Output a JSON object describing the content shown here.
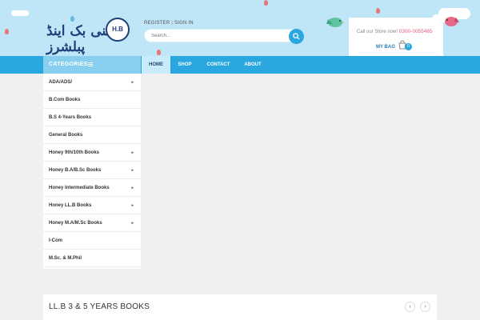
{
  "header": {
    "logo_text": "ہنی بک اینڈ پبلشرز",
    "logo_badge": "H.B",
    "register_label": "REGISTER",
    "signin_label": "SIGN IN",
    "separator": "|",
    "search_placeholder": "Search...",
    "call_label": "Call our Store now!",
    "phone": "0300-0055465",
    "bag_label": "MY BAG",
    "bag_count": "0"
  },
  "nav": {
    "categories_label": "CATEGORIES",
    "items": [
      {
        "label": "HOME"
      },
      {
        "label": "SHOP"
      },
      {
        "label": "CONTACT"
      },
      {
        "label": "ABOUT"
      }
    ]
  },
  "sidebar": {
    "items": [
      {
        "label": "ADA/ADS/",
        "arrow": "▸"
      },
      {
        "label": "B.Com Books",
        "arrow": ""
      },
      {
        "label": "B.S 4-Years Books",
        "arrow": ""
      },
      {
        "label": "General Books",
        "arrow": ""
      },
      {
        "label": "Honey 9th/10th Books",
        "arrow": "▸"
      },
      {
        "label": "Honey B.A/B.Sc Books",
        "arrow": "▸"
      },
      {
        "label": "Honey Intermediate Books",
        "arrow": "▸"
      },
      {
        "label": "Honey LL.B Books",
        "arrow": "▸"
      },
      {
        "label": "Honey M.A/M.Sc Books",
        "arrow": "▸"
      },
      {
        "label": "I-Com",
        "arrow": ""
      },
      {
        "label": "M.Sc. & M.Phil",
        "arrow": ""
      }
    ]
  },
  "section": {
    "title": "LL.B 3 & 5 YEARS BOOKS",
    "prev": "‹",
    "next": "›"
  },
  "colors": {
    "accent": "#2aa7df",
    "sky": "#bfe6f6",
    "phone": "#e85b7a"
  }
}
